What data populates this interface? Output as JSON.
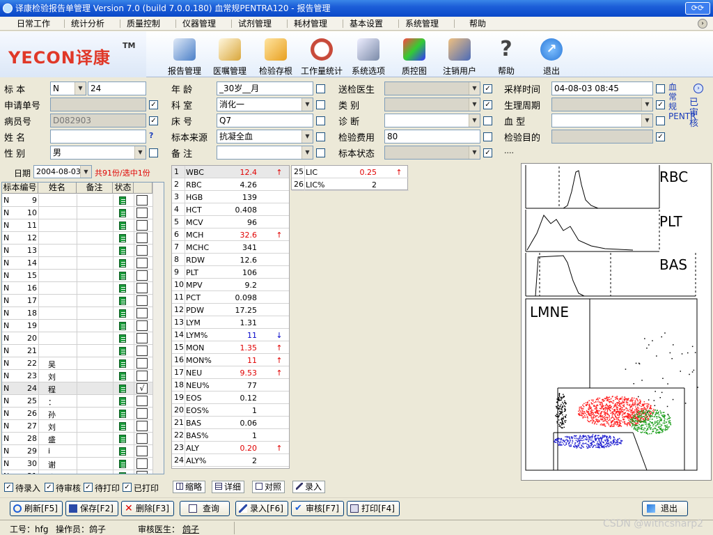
{
  "window": {
    "title": "译康检验报告单管理 Version 7.0 (build 7.0.0.180) 血常规PENTRA120 - 报告管理"
  },
  "menu": [
    "日常工作",
    "统计分析",
    "质量控制",
    "仪器管理",
    "试剂管理",
    "耗材管理",
    "基本设置",
    "系统管理",
    "帮助"
  ],
  "logo": {
    "text": "YECON译康",
    "tm": "TM"
  },
  "toolbar": [
    {
      "label": "报告管理",
      "icon": "report-icon",
      "color": "#4a7fc8"
    },
    {
      "label": "医嘱管理",
      "icon": "order-icon",
      "color": "#d9a63a"
    },
    {
      "label": "检验存根",
      "icon": "archive-box-icon",
      "color": "#e8a020"
    },
    {
      "label": "工作量统计",
      "icon": "clock-chart-icon",
      "color": "#c84a3a"
    },
    {
      "label": "系统选项",
      "icon": "options-icon",
      "color": "#7a8aa8"
    },
    {
      "label": "质控图",
      "icon": "qc-cubes-icon",
      "color": "#30a050"
    },
    {
      "label": "注销用户",
      "icon": "logout-user-icon",
      "color": "#4a6ab8"
    },
    {
      "label": "帮助",
      "icon": "help-icon",
      "color": "#444444"
    },
    {
      "label": "退出",
      "icon": "exit-icon",
      "color": "#2a78d8"
    }
  ],
  "form": {
    "labels": {
      "specimen": "标 本",
      "app_no": "申请单号",
      "patient_no": "病员号",
      "name": "姓 名",
      "sex": "性 别",
      "age": "年 龄",
      "dept": "科 室",
      "bed": "床 号",
      "source": "标本来源",
      "remark": "备 注",
      "doctor": "送检医生",
      "category": "类 别",
      "diagnosis": "诊 断",
      "fee": "检验费用",
      "status": "标本状态",
      "sample_time": "采样时间",
      "physio": "生理周期",
      "blood_type": "血 型",
      "purpose": "检验目的"
    },
    "specimen_type": "N",
    "specimen_no": "24",
    "app_no": "",
    "patient_no": "D082903",
    "name": "",
    "name_q": "?",
    "sex": "男",
    "age": "_30岁__月",
    "dept": "消化一",
    "bed": "Q7",
    "source": "抗凝全血",
    "remark": "",
    "doctor": "",
    "category": "",
    "diagnosis": "",
    "fee": "80",
    "status": "",
    "sample_time": "04-08-03 08:45",
    "physio": "",
    "blood_type": "",
    "purpose": "",
    "dots": "....",
    "vert1": "血常规PENTR",
    "vert2": "已审核"
  },
  "list": {
    "date_label": "日期",
    "date": "2004-08-03",
    "count_text": "共91份/选中1份",
    "headers": [
      "标本编号",
      "姓名",
      "备注",
      "状态"
    ],
    "rows": [
      {
        "t": "N",
        "no": "9",
        "name": ""
      },
      {
        "t": "N",
        "no": "10",
        "name": ""
      },
      {
        "t": "N",
        "no": "11",
        "name": ""
      },
      {
        "t": "N",
        "no": "12",
        "name": ""
      },
      {
        "t": "N",
        "no": "13",
        "name": ""
      },
      {
        "t": "N",
        "no": "14",
        "name": ""
      },
      {
        "t": "N",
        "no": "15",
        "name": ""
      },
      {
        "t": "N",
        "no": "16",
        "name": ""
      },
      {
        "t": "N",
        "no": "17",
        "name": ""
      },
      {
        "t": "N",
        "no": "18",
        "name": ""
      },
      {
        "t": "N",
        "no": "19",
        "name": ""
      },
      {
        "t": "N",
        "no": "20",
        "name": ""
      },
      {
        "t": "N",
        "no": "21",
        "name": ""
      },
      {
        "t": "N",
        "no": "22",
        "name": "吴"
      },
      {
        "t": "N",
        "no": "23",
        "name": "刘"
      },
      {
        "t": "N",
        "no": "24",
        "name": "程",
        "checked": "√"
      },
      {
        "t": "N",
        "no": "25",
        "name": "："
      },
      {
        "t": "N",
        "no": "26",
        "name": "孙"
      },
      {
        "t": "N",
        "no": "27",
        "name": "刘"
      },
      {
        "t": "N",
        "no": "28",
        "name": "盛"
      },
      {
        "t": "N",
        "no": "29",
        "name": "i"
      },
      {
        "t": "N",
        "no": "30",
        "name": "谢"
      },
      {
        "t": "N",
        "no": "31",
        "name": "许"
      }
    ],
    "filters": [
      "待录入",
      "待审核",
      "待打印",
      "已打印"
    ]
  },
  "results": [
    {
      "n": "1",
      "code": "WBC",
      "val": "12.4",
      "flag": "↑",
      "hi": true
    },
    {
      "n": "2",
      "code": "RBC",
      "val": "4.26",
      "flag": ""
    },
    {
      "n": "3",
      "code": "HGB",
      "val": "139",
      "flag": ""
    },
    {
      "n": "4",
      "code": "HCT",
      "val": "0.408",
      "flag": ""
    },
    {
      "n": "5",
      "code": "MCV",
      "val": "96",
      "flag": ""
    },
    {
      "n": "6",
      "code": "MCH",
      "val": "32.6",
      "flag": "↑",
      "hi": true
    },
    {
      "n": "7",
      "code": "MCHC",
      "val": "341",
      "flag": ""
    },
    {
      "n": "8",
      "code": "RDW",
      "val": "12.6",
      "flag": ""
    },
    {
      "n": "9",
      "code": "PLT",
      "val": "106",
      "flag": ""
    },
    {
      "n": "10",
      "code": "MPV",
      "val": "9.2",
      "flag": ""
    },
    {
      "n": "11",
      "code": "PCT",
      "val": "0.098",
      "flag": ""
    },
    {
      "n": "12",
      "code": "PDW",
      "val": "17.25",
      "flag": ""
    },
    {
      "n": "13",
      "code": "LYM",
      "val": "1.31",
      "flag": ""
    },
    {
      "n": "14",
      "code": "LYM%",
      "val": "11",
      "flag": "↓",
      "lo": true
    },
    {
      "n": "15",
      "code": "MON",
      "val": "1.35",
      "flag": "↑",
      "hi": true
    },
    {
      "n": "16",
      "code": "MON%",
      "val": "11",
      "flag": "↑",
      "hi": true
    },
    {
      "n": "17",
      "code": "NEU",
      "val": "9.53",
      "flag": "↑",
      "hi": true
    },
    {
      "n": "18",
      "code": "NEU%",
      "val": "77",
      "flag": ""
    },
    {
      "n": "19",
      "code": "EOS",
      "val": "0.12",
      "flag": ""
    },
    {
      "n": "20",
      "code": "EOS%",
      "val": "1",
      "flag": ""
    },
    {
      "n": "21",
      "code": "BAS",
      "val": "0.06",
      "flag": ""
    },
    {
      "n": "22",
      "code": "BAS%",
      "val": "1",
      "flag": ""
    },
    {
      "n": "23",
      "code": "ALY",
      "val": "0.20",
      "flag": "↑",
      "hi": true
    },
    {
      "n": "24",
      "code": "ALY%",
      "val": "2",
      "flag": ""
    }
  ],
  "results2": [
    {
      "n": "25",
      "code": "LIC",
      "val": "0.25",
      "flag": "↑",
      "hi": true
    },
    {
      "n": "26",
      "code": "LIC%",
      "val": "2",
      "flag": ""
    }
  ],
  "histograms": [
    "RBC",
    "PLT",
    "BAS",
    "LMNE"
  ],
  "tabs": [
    "缩略",
    "详细",
    "对照",
    "录入"
  ],
  "buttons": [
    "刷新[F5]",
    "保存[F2]",
    "删除[F3]",
    "查询",
    "录入[F6]",
    "审核[F7]",
    "打印[F4]",
    "退出"
  ],
  "status": {
    "worker": "工号：hfg",
    "operator": "操作员：鸽子",
    "reviewer_label": "审核医生：",
    "reviewer": "鸽子",
    "watermark": "CSDN @withcsharp2"
  },
  "colors": {
    "title": "#0a49c8",
    "high": "#e00000",
    "low": "#0000c8",
    "neu": "#ff2020",
    "mon": "#20a020",
    "lym": "#2020d0"
  }
}
